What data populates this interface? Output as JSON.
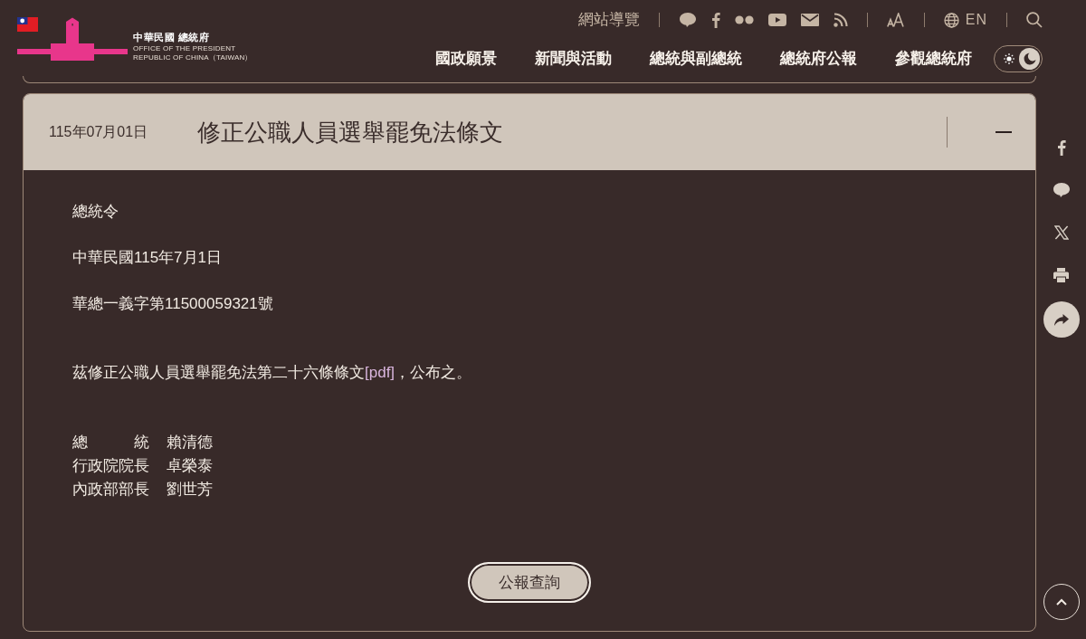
{
  "header": {
    "logo": {
      "name_zh": "中華民國 總統府",
      "name_en": [
        "OFFICE OF THE PRESIDENT",
        "REPUBLIC OF CHINA（TAIWAN）"
      ]
    },
    "utility_bar": {
      "sitemap_link": "網站導覽",
      "language_link": "EN"
    },
    "nav": [
      "國政願景",
      "新聞與活動",
      "總統與副總統",
      "總統府公報",
      "參觀總統府"
    ],
    "theme_toggle": [
      {
        "kind": "light",
        "selected": false
      },
      {
        "kind": "dark",
        "selected": true
      }
    ]
  },
  "gazette_item": {
    "date": "115年07月01日",
    "title": "修正公職人員選舉罷免法條文",
    "expanded": true,
    "body": {
      "heading": "總統令",
      "date_line": "中華民國115年7月1日",
      "document_number": "華總一義字第11500059321號",
      "decree": [
        {
          "kind": "text",
          "text": "茲修正公職人員選舉罷免法第二十六條條文"
        },
        {
          "kind": "link",
          "text": "[pdf]"
        },
        {
          "kind": "text",
          "text": "，公布之。"
        }
      ],
      "signatories": [
        {
          "title": "總　　　統",
          "name": "賴清德"
        },
        {
          "title": "行政院院長",
          "name": "卓榮泰"
        },
        {
          "title": "內政部部長",
          "name": "劉世芳"
        }
      ]
    },
    "search_button": "公報查詢"
  }
}
